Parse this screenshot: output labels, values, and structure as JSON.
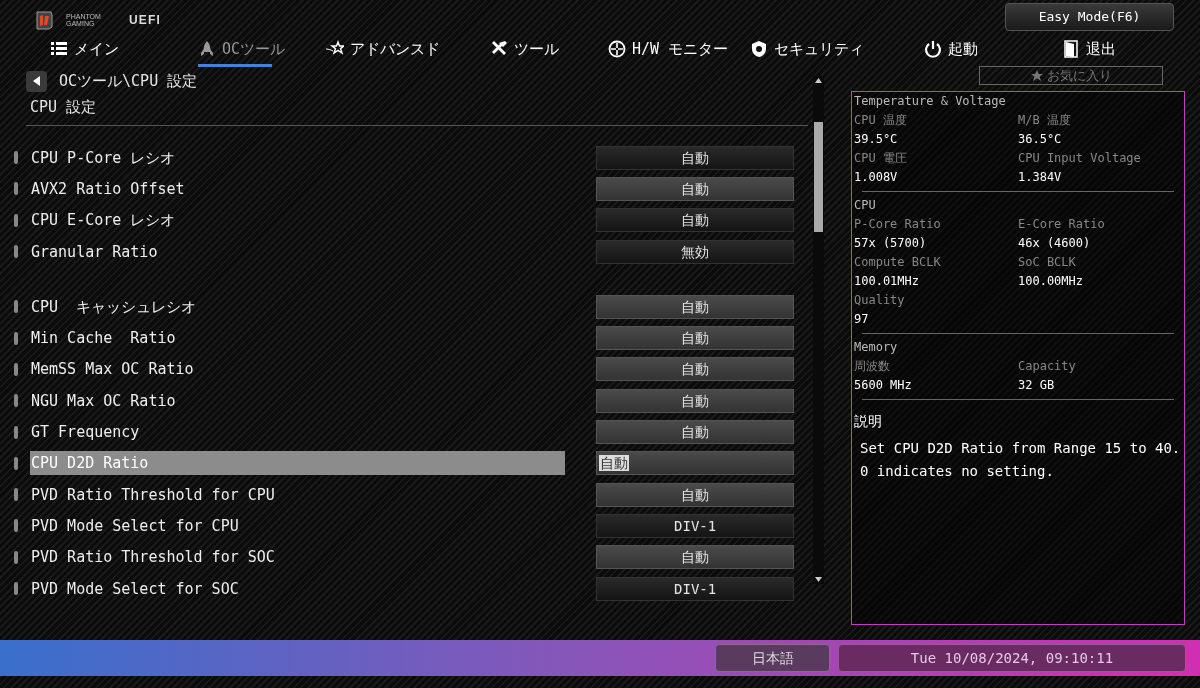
{
  "logo": {
    "brand_top": "PHANTOM",
    "brand_bottom": "GAMING",
    "product": "UEFI"
  },
  "easy_mode_button": "Easy Mode(F6)",
  "tabs": [
    {
      "label": "メイン",
      "selected": false
    },
    {
      "label": "OCツール",
      "selected": true
    },
    {
      "label": "アドバンスド",
      "selected": false
    },
    {
      "label": "ツール",
      "selected": false
    },
    {
      "label": "H/W モニター",
      "selected": false
    },
    {
      "label": "セキュリティ",
      "selected": false
    },
    {
      "label": "起動",
      "selected": false
    },
    {
      "label": "退出",
      "selected": false
    }
  ],
  "favorites_button": "お気に入り",
  "breadcrumb": "OCツール\\CPU 設定",
  "section_title": "CPU 設定",
  "setting_groups": [
    [
      {
        "label": "CPU P-Core レシオ",
        "value": "自動",
        "kind": "select",
        "selected": false
      },
      {
        "label": "AVX2 Ratio Offset",
        "value": "自動",
        "kind": "field",
        "selected": false
      },
      {
        "label": "CPU E-Core レシオ",
        "value": "自動",
        "kind": "select",
        "selected": false
      },
      {
        "label": "Granular Ratio",
        "value": "無効",
        "kind": "select",
        "selected": false
      }
    ],
    [
      {
        "label": "CPU  キャッシュレシオ",
        "value": "自動",
        "kind": "field",
        "selected": false
      },
      {
        "label": "Min Cache  Ratio",
        "value": "自動",
        "kind": "field",
        "selected": false
      },
      {
        "label": "MemSS Max OC Ratio",
        "value": "自動",
        "kind": "field",
        "selected": false
      },
      {
        "label": "NGU Max OC Ratio",
        "value": "自動",
        "kind": "field",
        "selected": false
      },
      {
        "label": "GT Frequency",
        "value": "自動",
        "kind": "field",
        "selected": false
      },
      {
        "label": "CPU D2D Ratio",
        "value": "自動",
        "kind": "field",
        "selected": true
      },
      {
        "label": "PVD Ratio Threshold for CPU",
        "value": "自動",
        "kind": "field",
        "selected": false
      },
      {
        "label": "PVD Mode Select for CPU",
        "value": "DIV-1",
        "kind": "select",
        "selected": false
      },
      {
        "label": "PVD Ratio Threshold for SOC",
        "value": "自動",
        "kind": "field",
        "selected": false
      },
      {
        "label": "PVD Mode Select for SOC",
        "value": "DIV-1",
        "kind": "select",
        "selected": false
      }
    ]
  ],
  "info_panel": {
    "sections": [
      {
        "title": "Temperature & Voltage",
        "items": [
          {
            "label": "CPU 温度",
            "value": "39.5°C"
          },
          {
            "label": "M/B 温度",
            "value": "36.5°C"
          },
          {
            "label": "CPU 電圧",
            "value": "1.008V"
          },
          {
            "label": "CPU Input Voltage",
            "value": "1.384V"
          }
        ]
      },
      {
        "title": "CPU",
        "items": [
          {
            "label": "P-Core Ratio",
            "value": "57x (5700)"
          },
          {
            "label": "E-Core Ratio",
            "value": "46x (4600)"
          },
          {
            "label": "Compute BCLK",
            "value": "100.01MHz"
          },
          {
            "label": "SoC BCLK",
            "value": "100.00MHz"
          },
          {
            "label": "Quality",
            "value": "97"
          }
        ]
      },
      {
        "title": "Memory",
        "items": [
          {
            "label": "周波数",
            "value": "5600 MHz"
          },
          {
            "label": "Capacity",
            "value": "32 GB"
          }
        ]
      }
    ],
    "description_title": "説明",
    "description": "Set CPU D2D Ratio from Range 15 to 40.\n0 indicates no setting."
  },
  "status_bar": {
    "language": "日本語",
    "datetime": "Tue 10/08/2024, 09:10:11"
  }
}
